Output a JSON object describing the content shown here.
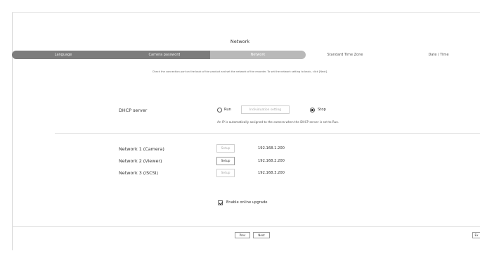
{
  "page": {
    "title": "Network"
  },
  "steps": [
    {
      "label": "Language",
      "state": "done"
    },
    {
      "label": "Camera password",
      "state": "done"
    },
    {
      "label": "Network",
      "state": "active"
    },
    {
      "label": "Standard Time Zone",
      "state": "pending"
    },
    {
      "label": "Date / Time",
      "state": "pending"
    }
  ],
  "instruction": "Check the connection port on the back of the product and set the network of the recorder. To set the network setting to basic, click [Next].",
  "dhcp": {
    "label": "DHCP server",
    "run_label": "Run",
    "individuation_label": "Individuation setting",
    "stop_label": "Stop",
    "selected": "Stop",
    "note": "An IP is automatically assigned to the camera when the DHCP server is set to Run."
  },
  "networks": [
    {
      "label": "Network 1 (Camera)",
      "button": "Setup",
      "button_enabled": false,
      "ip": "192.168.1.200"
    },
    {
      "label": "Network 2 (Viewer)",
      "button": "Setup",
      "button_enabled": true,
      "ip": "192.168.2.200"
    },
    {
      "label": "Network 3 (iSCSI)",
      "button": "Setup",
      "button_enabled": false,
      "ip": "192.168.3.200"
    }
  ],
  "upgrade": {
    "label": "Enable online upgrade",
    "checked": true
  },
  "footer": {
    "prev_label": "Prev",
    "next_label": "Next",
    "exit_label": "Ex"
  },
  "colors": {
    "step_done": "#7c7c7c",
    "step_active": "#b9b9b9"
  }
}
